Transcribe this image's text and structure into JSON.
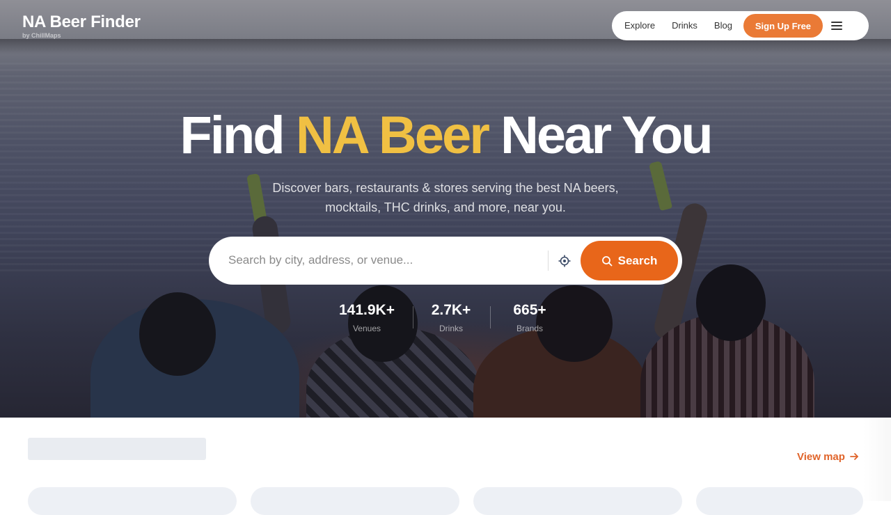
{
  "brand": {
    "title": "NA Beer Finder",
    "subtitle": "by ChillMaps"
  },
  "nav": {
    "links": [
      "Explore",
      "Drinks",
      "Blog"
    ],
    "signup_label": "Sign Up Free",
    "menu_icon": "menu-icon"
  },
  "hero": {
    "headline_start": "Find",
    "headline_accent": "NA Beer",
    "headline_end": "Near You",
    "subheadline": "Discover bars, restaurants & stores serving the best NA beers, mocktails, THC drinks, and more, near you."
  },
  "search": {
    "placeholder": "Search by city, address, or venue...",
    "value": "",
    "locate_icon": "locate-icon",
    "button_icon": "search-icon",
    "button_label": "Search"
  },
  "stats": [
    {
      "value": "141.9K+",
      "label": "Venues"
    },
    {
      "value": "2.7K+",
      "label": "Drinks"
    },
    {
      "value": "665+",
      "label": "Brands"
    }
  ],
  "section": {
    "view_map_label": "View map",
    "view_map_icon": "arrow-right-icon"
  },
  "colors": {
    "accent_orange": "#e8661a",
    "signup_orange": "#ea7a36",
    "headline_yellow": "#f0c043",
    "link_orange": "#e0642a",
    "skeleton": "#e9ecf1"
  }
}
